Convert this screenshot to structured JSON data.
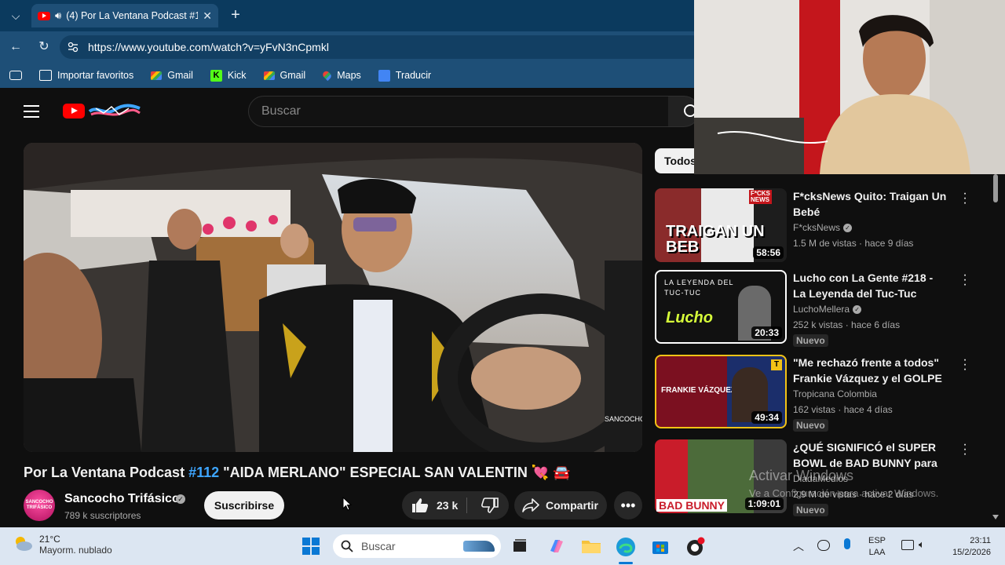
{
  "browser": {
    "tab_title": "(4) Por La Ventana Podcast #1",
    "url": "https://www.youtube.com/watch?v=yFvN3nCpmkl",
    "bookmarks": [
      {
        "label": "Importar favoritos",
        "icon": "import-icon"
      },
      {
        "label": "Gmail",
        "icon": "gmail-icon"
      },
      {
        "label": "Kick",
        "icon": "kick-icon"
      },
      {
        "label": "Gmail",
        "icon": "gmail-icon"
      },
      {
        "label": "Maps",
        "icon": "maps-icon"
      },
      {
        "label": "Traducir",
        "icon": "translate-icon"
      }
    ]
  },
  "youtube": {
    "search_placeholder": "Buscar",
    "video": {
      "title_prefix": "Por La Ventana Podcast ",
      "title_tag": "#112",
      "title_rest": " \"AIDA MERLANO\" ESPECIAL SAN VALENTIN 💘 🚘",
      "channel": "Sancocho Trifásico",
      "subscribers": "789 k suscriptores",
      "avatar_text": "SANCOCHO TRIFÁSICO",
      "subscribe_label": "Suscribirse",
      "likes": "23 k",
      "share_label": "Compartir"
    },
    "chip_label": "Todos",
    "recommendations": [
      {
        "title": "F*cksNews Quito: Traigan Un Bebé",
        "channel": "F*cksNews",
        "verified": true,
        "meta": "1.5 M de vistas · hace 9 días",
        "duration": "58:56",
        "badge": "",
        "thumb_text": "TRAIGAN UN BEB"
      },
      {
        "title": "Lucho con La Gente #218 - La Leyenda del Tuc-Tuc",
        "channel": "LuchoMellera",
        "verified": true,
        "meta": "252 k vistas · hace 6 días",
        "duration": "20:33",
        "badge": "Nuevo",
        "thumb_text": "LA LEYENDA DEL TUC-TUC"
      },
      {
        "title": "\"Me rechazó frente a todos\" Frankie Vázquez y el GOLPE ...",
        "channel": "Tropicana Colombia",
        "verified": false,
        "meta": "162 vistas · hace 4 días",
        "duration": "49:34",
        "badge": "Nuevo",
        "thumb_text": "FRANKIE VÁZQUEZ"
      },
      {
        "title": "¿QUÉ SIGNIFICÓ el SUPER BOWL de BAD BUNNY para los...",
        "channel": "DiadaMedios",
        "verified": false,
        "meta": "2.9 M de vistas · hace 2 días",
        "duration": "1:09:01",
        "badge": "Nuevo",
        "thumb_text": "BAD BUNNY"
      }
    ],
    "watermark_line1": "Activar Windows",
    "watermark_line2": "Ve a Configuración para activar Windows."
  },
  "taskbar": {
    "weather_temp": "21°C",
    "weather_desc": "Mayorm. nublado",
    "search_placeholder": "Buscar",
    "lang_1": "ESP",
    "lang_2": "LAA",
    "time": "23:11",
    "date": "15/2/2026"
  },
  "colors": {
    "youtube_red": "#ff0000",
    "link_blue": "#3ea6ff",
    "browser_chrome": "#1e4f77",
    "page_bg": "#0f0f0f"
  }
}
